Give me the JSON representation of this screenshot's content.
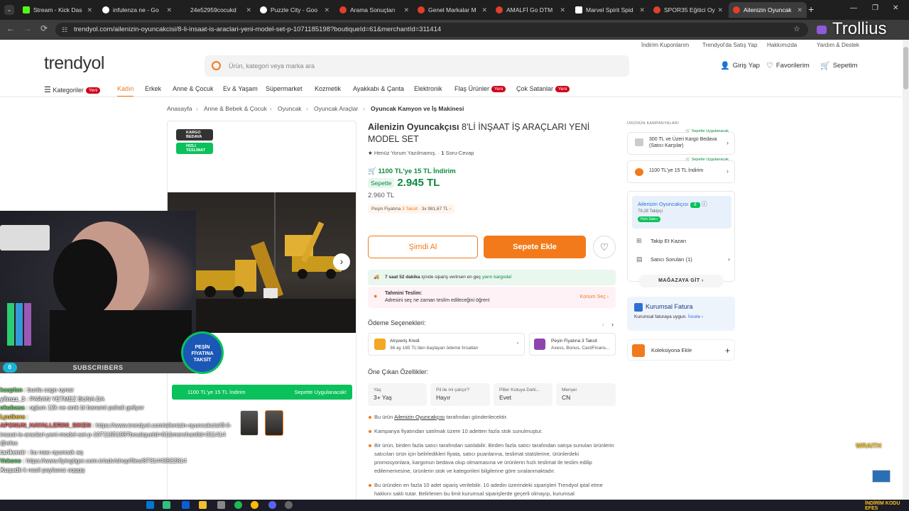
{
  "browser": {
    "tabs": [
      {
        "label": "Stream - Kick Das",
        "color": "#53fc18"
      },
      {
        "label": "infulenza ne - Go",
        "color": "#ffffff"
      },
      {
        "label": "24e52959cocukd",
        "color": "#3c3c3c"
      },
      {
        "label": "Puzzle City - Goo",
        "color": "#ffffff"
      },
      {
        "label": "Arama Sonuçları",
        "color": "#e43f2b"
      },
      {
        "label": "Genel Markalar M",
        "color": "#e43f2b"
      },
      {
        "label": "AMALFİ Go DTM",
        "color": "#e43f2b"
      },
      {
        "label": "Marvel Spirit Spid",
        "color": "#ffffff"
      },
      {
        "label": "SPOR35 Eğitici Oy",
        "color": "#e43f2b"
      },
      {
        "label": "Ailenizin Oyuncak",
        "color": "#e43f2b"
      }
    ],
    "url": "trendyol.com/ailenizin-oyuncakcisi/8-li-insaat-is-araclari-yeni-model-set-p-1071185198?boutiqueId=61&merchantId=311414"
  },
  "header": {
    "top_links": [
      "İndirim Kuponlarım",
      "Trendyol'da Satış Yap",
      "Hakkımızda",
      "Yardım & Destek"
    ],
    "logo": "trendyol",
    "search_placeholder": "Ürün, kategori veya marka ara",
    "login": "Giriş Yap",
    "favorites": "Favorilerim",
    "cart": "Sepetim"
  },
  "categories": {
    "all": "Kategoriler",
    "badge": "Yeni",
    "items": [
      "Kadın",
      "Erkek",
      "Anne & Çocuk",
      "Ev & Yaşam",
      "Süpermarket",
      "Kozmetik",
      "Ayakkabı & Çanta",
      "Elektronik",
      "Flaş Ürünler",
      "Çok Satanlar"
    ]
  },
  "breadcrumb": [
    "Anasayfa",
    "Anne & Bebek & Çocuk",
    "Oyuncak",
    "Oyuncak Araçlar",
    "Oyuncak Kamyon ve İş Makinesi"
  ],
  "gallery": {
    "badge_cargo": "KARGO BEDAVA",
    "badge_fast": "HIZLI TESLİMAT",
    "strip_left": "1100 TL'ye 15 TL İndirim",
    "strip_right": "Sepette Uygulanacak!",
    "peshin": "PEŞİN FİYATINA TAKSİT"
  },
  "product": {
    "brand": "Ailenizin Oyuncakçısı",
    "title": "8'Lİ İNŞAAT İŞ ARAÇLARI YENİ MODEL SET",
    "rating_text": "Henüz Yorum Yazılmamış.",
    "qa_count": "1",
    "qa_label": "Soru-Cevap",
    "promo": "1100 TL'ye 15 TL İndirim",
    "sepette_label": "Sepette",
    "sepette_price": "2.945 TL",
    "old_price": "2.960 TL",
    "taksit_prefix": "Peşin Fiyatına",
    "taksit_count": "3 Taksit",
    "taksit_detail": "3x 981,67 TL",
    "buy_now": "Şimdi Al",
    "add_to_cart": "Sepete Ekle",
    "cargo_time": "7 saat 52 dakika",
    "cargo_mid": "içinde sipariş verirsen en geç",
    "cargo_end": "yarın kargoda!",
    "delivery_title": "Tahmini Teslim:",
    "delivery_text": "Adresini seç ne zaman teslim edileceğini öğren!",
    "delivery_action": "Konum Seç",
    "payment_title": "Ödeme Seçenekleri:",
    "payment_cards": [
      {
        "title": "Alışveriş Kredi",
        "sub": "36 ay 165 TL'den başlayan ödeme fırsatları"
      },
      {
        "title": "Peşin Fiyatına 3 Taksit",
        "sub": "Axess, Bonus, CardFinans..."
      }
    ],
    "features_title": "Öne Çıkan Özellikler:",
    "features": [
      {
        "label": "Yaş",
        "value": "3+ Yaş"
      },
      {
        "label": "Pil ile mi çalışır?",
        "value": "Hayır"
      },
      {
        "label": "Piller Kutuya Dahi...",
        "value": "Evet"
      },
      {
        "label": "Menşei",
        "value": "CN"
      }
    ],
    "bullets": [
      "Bu ürün Ailenizin Oyuncakçısı tarafından gönderilecektir.",
      "Kampanya fiyatından satılmak üzere 10 adetten fazla stok sunulmuştur.",
      "Bir ürün, birden fazla satıcı tarafından satılabilir. Birden fazla satıcı tarafından satışa sunulan ürünlerin satıcıları ürün için belirledikleri fiyata, satıcı puanlarına, teslimat statülerine, ürünlerdeki promosyonlara, kargonun bedava olup olmamasına ve ürünlerin hızlı teslimat ile teslim edilip edilememesine, ürünlerin stok ve kategorileri bilgilerine göre sıralanmaktadır.",
      "Bu üründen en fazla 10 adet sipariş verilebilir. 10 adedin üzerindeki siparişleri Trendyol iptal etme hakkını saklı tutar. Belirlenen bu limit kurumsal siparişlerde geçerli olmayıp, kurumsal"
    ]
  },
  "sidebar": {
    "campaigns_title": "ÜRÜNÜN KAMPANYALARI",
    "campaigns": [
      {
        "tag": "Sepette Uygulanacak",
        "text": "300 TL ve Üzeri Kargo Bedava (Satıcı Karşılar)"
      },
      {
        "tag": "Sepette Uygulanacak",
        "text": "1100 TL'ye 15 TL İndirim"
      }
    ],
    "seller_name": "Ailenizin Oyuncakçısı",
    "seller_score": "8",
    "followers": "79,28 Takipçi",
    "fast_seller": "Hızlı Satıcı",
    "follow": "Takip Et Kazan",
    "questions": "Satıcı Soruları (1)",
    "store": "MAĞAZAYA GİT",
    "corporate_title": "Kurumsal Fatura",
    "corporate_sub": "Kurumsal faturaya uygun.",
    "corporate_link": "İncele",
    "collection": "Koleksiyona Ekle"
  },
  "overlay": {
    "watermark": "Trollius",
    "subscribers_count": "0",
    "subscribers_label": "SUBSCRIBERS",
    "wraith": "WRAITH",
    "chat": [
      {
        "user": "kaaplan",
        "msg": ": bunla cage oynar",
        "color": "#6fdc6f"
      },
      {
        "user": "yilmzz_3",
        "msg": ": PARAN YETMEZ BUNA DA",
        "color": "#ffffff"
      },
      {
        "user": "okubasa",
        "msg": ": oglum 12k ne amk bi banami pahali geliyor",
        "color": "#6fdc6f"
      },
      {
        "user": "Lyutkera",
        "msg": ":",
        "color": "#f9c21b"
      },
      {
        "user": "APONUN_HAYALLERINI_SIKEN",
        "msg": ": https://www.trendyol.com/ailenizin-oyuncakcisi/8-li-insaat-is-araclari-yeni-model-set-p-1071185198?boutiqueId=61&merchantId=311414 @efes",
        "color": "#ff6b6b"
      },
      {
        "user": "tarikemir",
        "msg": ": bu nası oyuncak aq",
        "color": "#ffffff"
      },
      {
        "user": "Vekone",
        "msg": ": https://www.flyingtiger.com.tr/adv/shop/files/8731443822814",
        "color": "#6fdc6f"
      },
      {
        "user": "Kuşadlı",
        "msg": "k nasil paylasoz aqqqq",
        "color": "#ffffff"
      }
    ]
  },
  "taskbar": {
    "tray": "İNDİRİM KODU EFES"
  }
}
